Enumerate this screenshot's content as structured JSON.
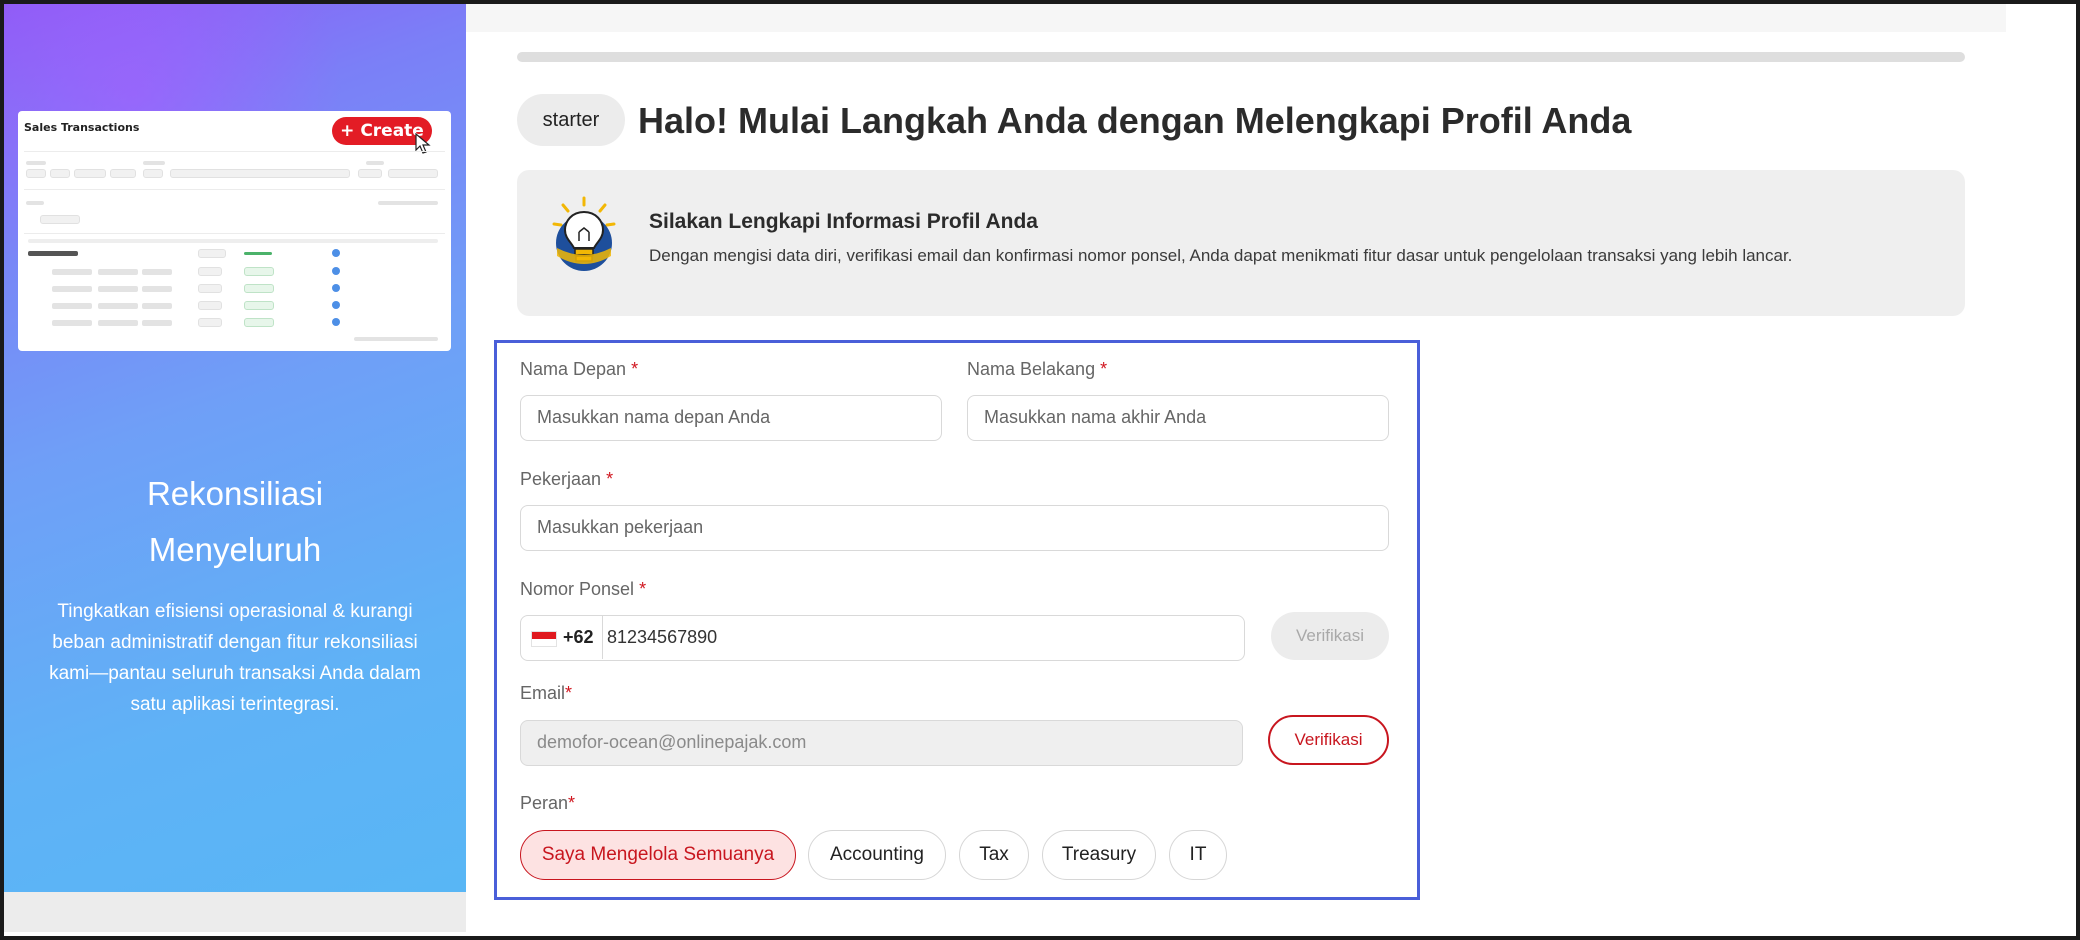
{
  "left_panel": {
    "preview": {
      "title": "Sales Transactions",
      "create_label": "+ Create"
    },
    "title_line1": "Rekonsiliasi",
    "title_line2": "Menyeluruh",
    "subtitle": "Tingkatkan efisiensi operasional & kurangi beban administratif dengan fitur rekonsiliasi kami—pantau seluruh transaksi Anda dalam satu aplikasi terintegrasi."
  },
  "header": {
    "plan_badge": "starter",
    "title": "Halo! Mulai Langkah Anda dengan Melengkapi Profil Anda"
  },
  "info": {
    "title": "Silakan Lengkapi Informasi Profil Anda",
    "text": "Dengan mengisi data diri, verifikasi email dan konfirmasi nomor ponsel, Anda dapat menikmati fitur dasar untuk pengelolaan transaksi yang lebih lancar."
  },
  "form": {
    "first_name": {
      "label": "Nama Depan",
      "placeholder": "Masukkan nama depan Anda"
    },
    "last_name": {
      "label": "Nama Belakang",
      "placeholder": "Masukkan nama akhir Anda"
    },
    "job": {
      "label": "Pekerjaan",
      "placeholder": "Masukkan pekerjaan"
    },
    "phone": {
      "label": "Nomor Ponsel",
      "country_code": "+62",
      "value": "81234567890",
      "verify_label": "Verifikasi"
    },
    "email": {
      "label": "Email",
      "value": "demofor-ocean@onlinepajak.com",
      "verify_label": "Verifikasi"
    },
    "role": {
      "label": "Peran",
      "options": [
        "Saya Mengelola Semuanya",
        "Accounting",
        "Tax",
        "Treasury",
        "IT"
      ],
      "selected": "Saya Mengelola Semuanya"
    },
    "required_mark": "*"
  },
  "colors": {
    "accent_red": "#c8161f",
    "form_border": "#4a5fd9"
  }
}
